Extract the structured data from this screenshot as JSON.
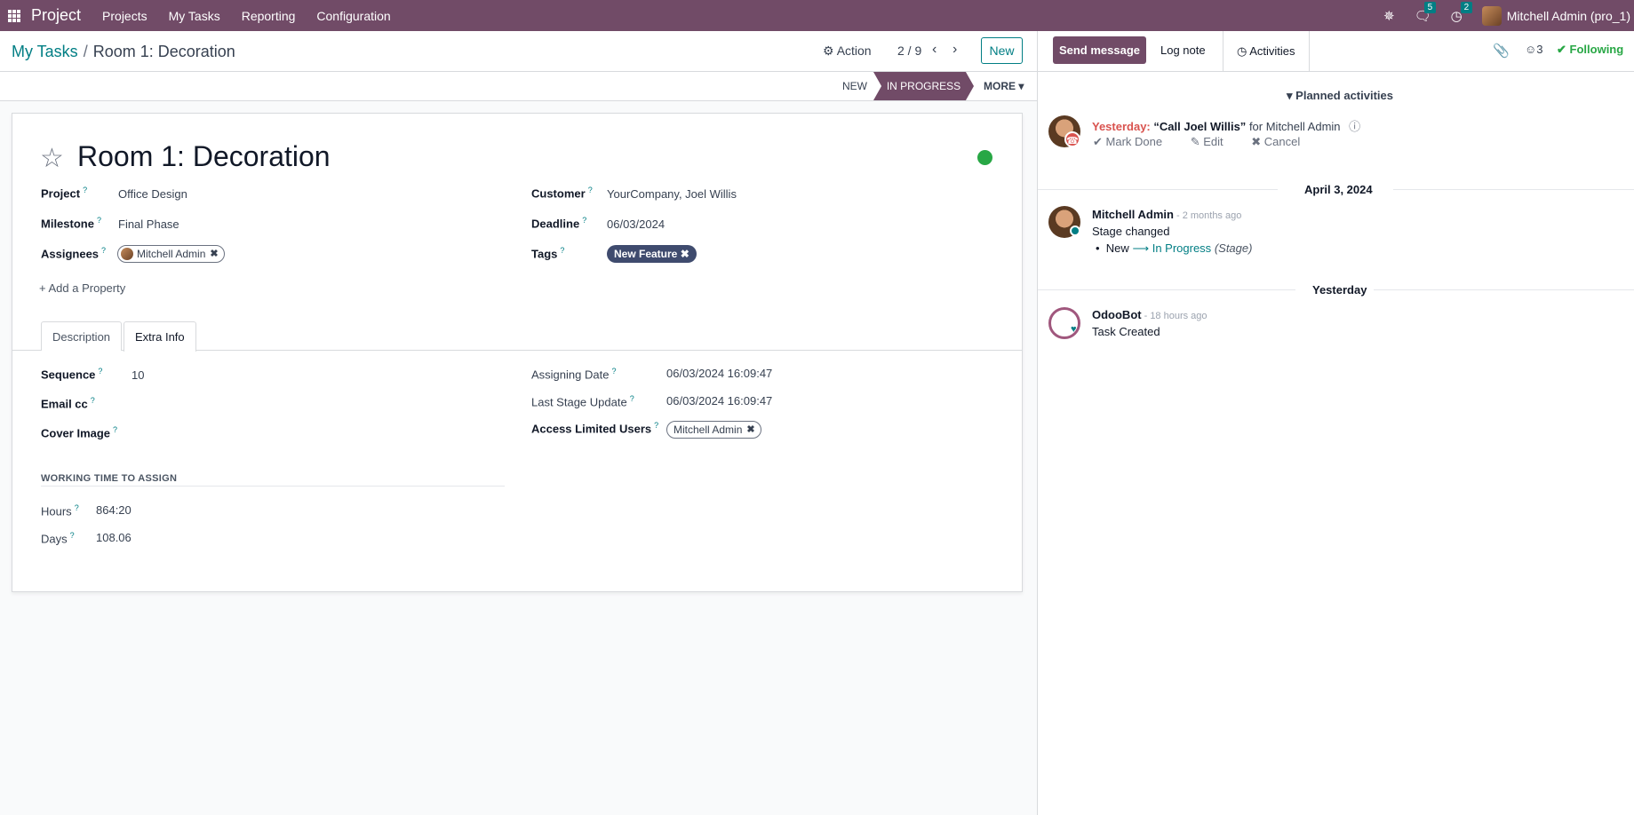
{
  "navbar": {
    "app_name": "Project",
    "menus": [
      "Projects",
      "My Tasks",
      "Reporting",
      "Configuration"
    ],
    "messages_count": "5",
    "activities_count": "2",
    "user": "Mitchell Admin (pro_1)"
  },
  "control": {
    "breadcrumb_parent": "My Tasks",
    "breadcrumb_sep": "/",
    "breadcrumb_current": "Room 1: Decoration",
    "action_label": "Action",
    "pager": "2 / 9",
    "new_label": "New"
  },
  "status": {
    "stages": [
      "New",
      "In Progress"
    ],
    "active_stage": "In Progress",
    "more_label": "MORE"
  },
  "task": {
    "title": "Room 1: Decoration",
    "fields_left": [
      {
        "label": "Project",
        "value": "Office Design"
      },
      {
        "label": "Milestone",
        "value": "Final Phase"
      },
      {
        "label": "Assignees",
        "value": "Mitchell Admin"
      }
    ],
    "fields_right": [
      {
        "label": "Customer",
        "value": "YourCompany, Joel Willis"
      },
      {
        "label": "Deadline",
        "value": "06/03/2024"
      },
      {
        "label": "Tags",
        "value": "New Feature"
      }
    ],
    "add_property": "Add a Property",
    "tabs": [
      "Description",
      "Extra Info"
    ],
    "active_tab": "Extra Info",
    "extra_left": [
      {
        "label": "Sequence",
        "value": "10"
      },
      {
        "label": "Email cc",
        "value": ""
      },
      {
        "label": "Cover Image",
        "value": ""
      }
    ],
    "extra_right": [
      {
        "label": "Assigning Date",
        "value": "06/03/2024 16:09:47"
      },
      {
        "label": "Last Stage Update",
        "value": "06/03/2024 16:09:47"
      },
      {
        "label": "Access Limited Users",
        "value": "Mitchell Admin"
      }
    ],
    "working_time_title": "WORKING TIME TO ASSIGN",
    "working_time": [
      {
        "label": "Hours",
        "value": "864:20"
      },
      {
        "label": "Days",
        "value": "108.06"
      }
    ]
  },
  "chatter": {
    "send_message": "Send message",
    "log_note": "Log note",
    "activities": "Activities",
    "followers_count": "3",
    "following": "Following",
    "planned_title": "Planned activities",
    "planned": {
      "when": "Yesterday:",
      "summary": "“Call Joel Willis”",
      "for_text": "for Mitchell Admin",
      "actions": [
        "Mark Done",
        "Edit",
        "Cancel"
      ]
    },
    "date1": "April 3, 2024",
    "msg1": {
      "author": "Mitchell Admin",
      "time": "- 2 months ago",
      "text": "Stage changed",
      "old_stage": "New",
      "new_stage": "In Progress",
      "field": "(Stage)"
    },
    "date2": "Yesterday",
    "msg2": {
      "author": "OdooBot",
      "time": "- 18 hours ago",
      "text": "Task Created"
    }
  },
  "colors": {
    "brand": "#714b67",
    "accent": "#017e84",
    "tag": "#3f4b6e",
    "status_green": "#28a745"
  }
}
